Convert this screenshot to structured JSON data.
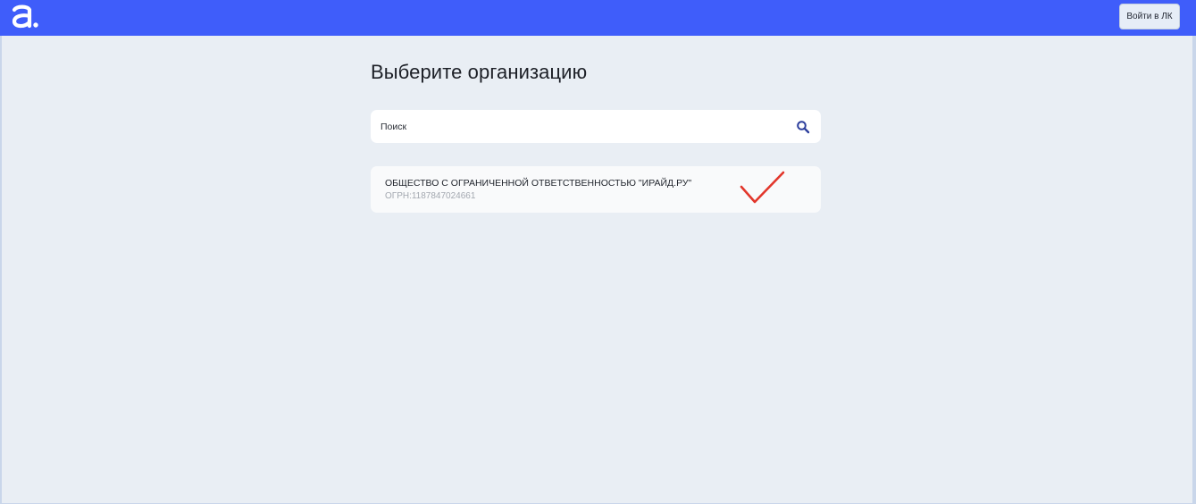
{
  "header": {
    "logo_icon": "app-logo-icon",
    "login_label": "Войти в ЛК",
    "bar_color": "#3f5dfa"
  },
  "main": {
    "title": "Выберите организацию",
    "search": {
      "placeholder": "Поиск",
      "value": "",
      "icon": "search-icon",
      "icon_color": "#2c3e9c"
    },
    "organizations": [
      {
        "name": "ОБЩЕСТВО С ОГРАНИЧЕННОЙ ОТВЕТСТВЕННОСТЬЮ \"ИРАЙД.РУ\"",
        "ogrn": "ОГРН:1187847024661",
        "annotation_icon": "checkmark-icon",
        "annotation_color": "#e2362b"
      }
    ]
  }
}
